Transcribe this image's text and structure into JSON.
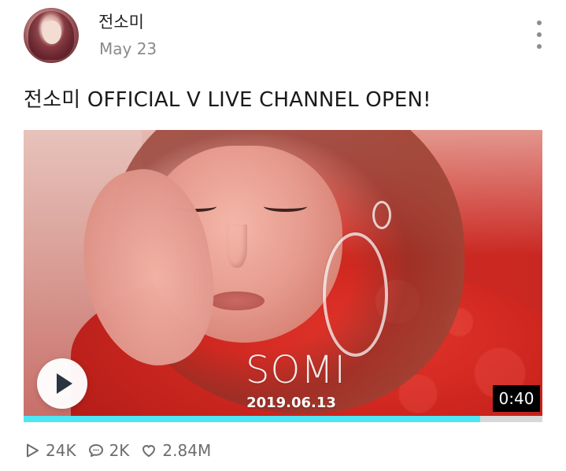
{
  "post": {
    "author": "전소미",
    "date": "May 23",
    "title": "전소미 OFFICIAL V LIVE CHANNEL OPEN!"
  },
  "video": {
    "overlay_title": "SOMI",
    "overlay_date": "2019.06.13",
    "duration": "0:40",
    "progress_fraction": 0.88
  },
  "stats": {
    "plays": "24K",
    "comments": "2K",
    "likes": "2.84M"
  },
  "icons": {
    "play": "play-icon",
    "more": "more-options-icon",
    "plays": "play-outline-icon",
    "comments": "comment-icon",
    "likes": "heart-icon"
  }
}
